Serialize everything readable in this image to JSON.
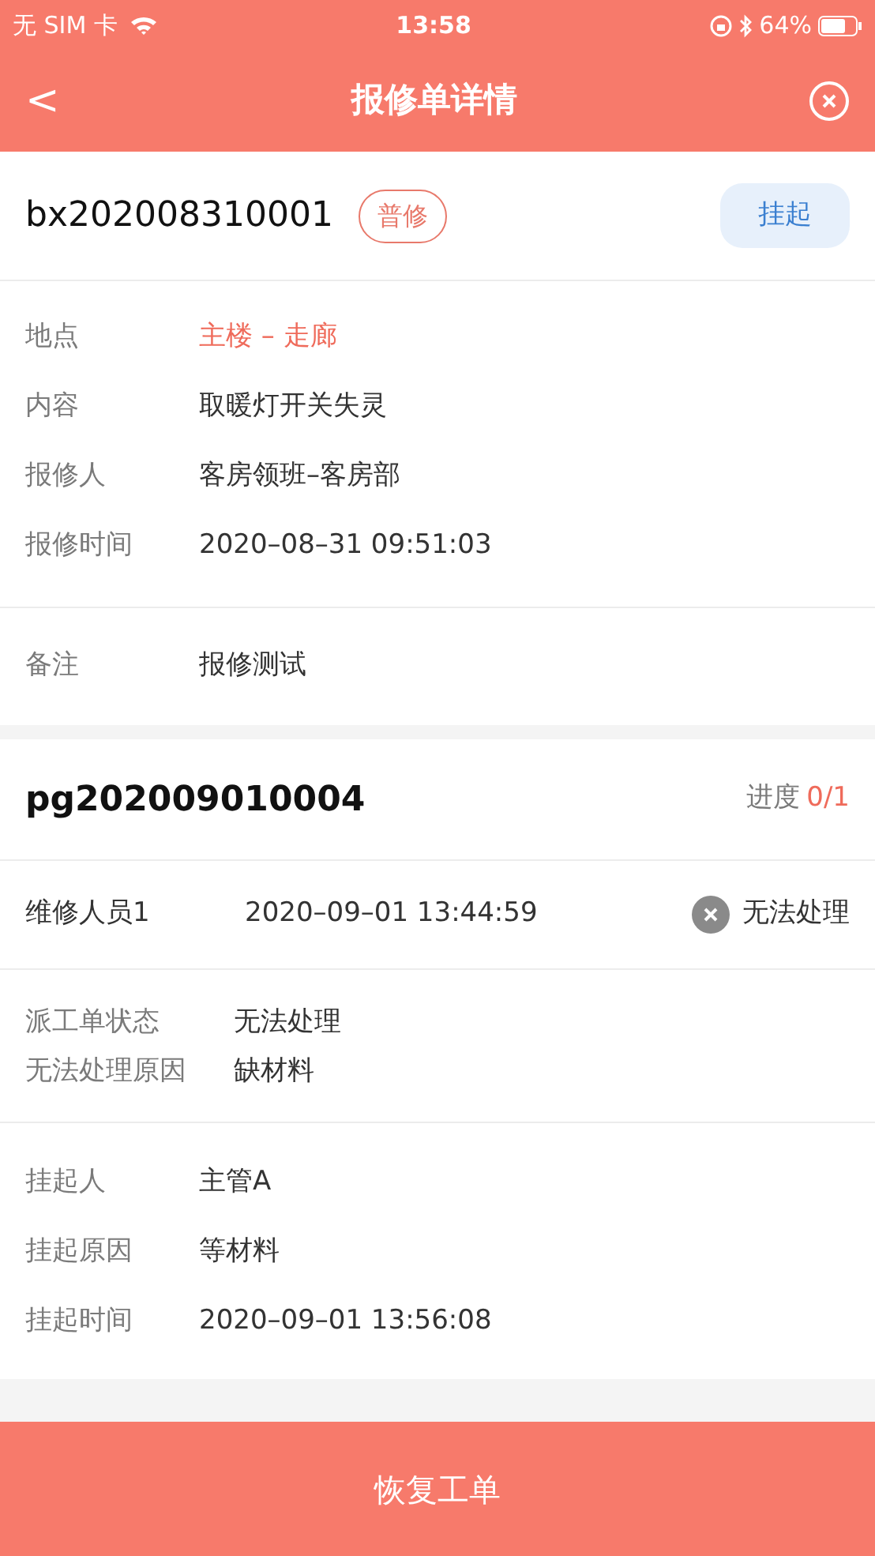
{
  "status_bar": {
    "carrier": "无 SIM 卡",
    "time": "13:58",
    "battery": "64%"
  },
  "header": {
    "back": "<",
    "title": "报修单详情"
  },
  "order": {
    "number": "bx202008310001",
    "tag": "普修",
    "action": "挂起",
    "fields": [
      {
        "label": "地点",
        "value": "主楼 – 走廊",
        "highlight": true
      },
      {
        "label": "内容",
        "value": "取暖灯开关失灵",
        "highlight": false
      },
      {
        "label": "报修人",
        "value": "客房领班–客房部",
        "highlight": false
      },
      {
        "label": "报修时间",
        "value": "2020–08–31 09:51:03",
        "highlight": false
      }
    ],
    "remark": {
      "label": "备注",
      "value": "报修测试"
    }
  },
  "dispatch": {
    "number": "pg202009010004",
    "progress_label": "进度",
    "progress": "0/1",
    "worker": {
      "name": "维修人员1",
      "time": "2020–09–01 13:44:59",
      "result": "无法处理"
    },
    "status_fields": [
      {
        "label": "派工单状态",
        "value": "无法处理"
      },
      {
        "label": "无法处理原因",
        "value": "缺材料"
      }
    ],
    "hang_fields": [
      {
        "label": "挂起人",
        "value": "主管A"
      },
      {
        "label": "挂起原因",
        "value": "等材料"
      },
      {
        "label": "挂起时间",
        "value": "2020–09–01 13:56:08"
      }
    ]
  },
  "footer_button": "恢复工单"
}
